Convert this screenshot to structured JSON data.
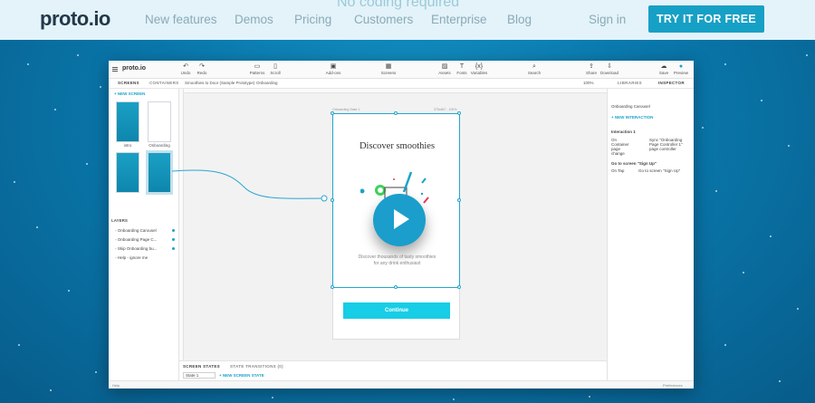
{
  "nav": {
    "ghost_text": "No coding required",
    "logo": "proto.io",
    "links": [
      "New features",
      "Demos",
      "Pricing",
      "Customers",
      "Enterprise",
      "Blog"
    ],
    "signin": "Sign in",
    "cta": "TRY IT FOR FREE"
  },
  "app": {
    "logo": "proto.io",
    "toolbar": [
      "Undo",
      "Redo",
      "Patterns",
      "Scroll",
      "Add-ons",
      "Screens",
      "Assets",
      "Fonts",
      "Variables",
      "Search",
      "Share",
      "Download",
      "Save",
      "Preview"
    ],
    "tabs": {
      "screens": "SCREENS",
      "containers": "CONTAINERS",
      "libraries": "LIBRARIES",
      "inspector": "INSPECTOR"
    },
    "breadcrumb": [
      "Smoothies to Door (Sample Prototype)",
      "Onboarding"
    ],
    "zoom": "100%",
    "new_screen": "+ NEW SCREEN",
    "screens": [
      {
        "label": "intro"
      },
      {
        "label": "Onboarding"
      }
    ],
    "layers_title": "LAYERS",
    "layers": [
      "Onboarding Carousel",
      "Onboarding Page C...",
      "Skip Onboarding bu...",
      "Help - ignore me"
    ],
    "canvas": {
      "frame_label": "Onboarding State 1",
      "frame_size": "375x667 - 100%",
      "title": "Discover smoothies",
      "subtitle_1": "Discover thousands of tasty smoothies",
      "subtitle_2": "for any drink enthusiast",
      "button": "Continue"
    },
    "bottom": {
      "tab1": "SCREEN STATES",
      "tab2": "STATE TRANSITIONS (0)",
      "state": "State 1",
      "new_state": "+ NEW SCREEN STATE"
    },
    "inspector": {
      "element": "Onboarding Carousel",
      "new_interaction": "+ NEW INTERACTION",
      "interaction_title": "Interaction 1",
      "on_change": "On Container page change",
      "sync": "Sync \"Onboarding Page Controller 1\" page controller",
      "signup_title": "Go to screen \"Sign Up\"",
      "on_tap": "On Tap",
      "goto": "Go to screen \"Sign Up\""
    },
    "status_left": "Help",
    "status_right": "Preferences"
  }
}
